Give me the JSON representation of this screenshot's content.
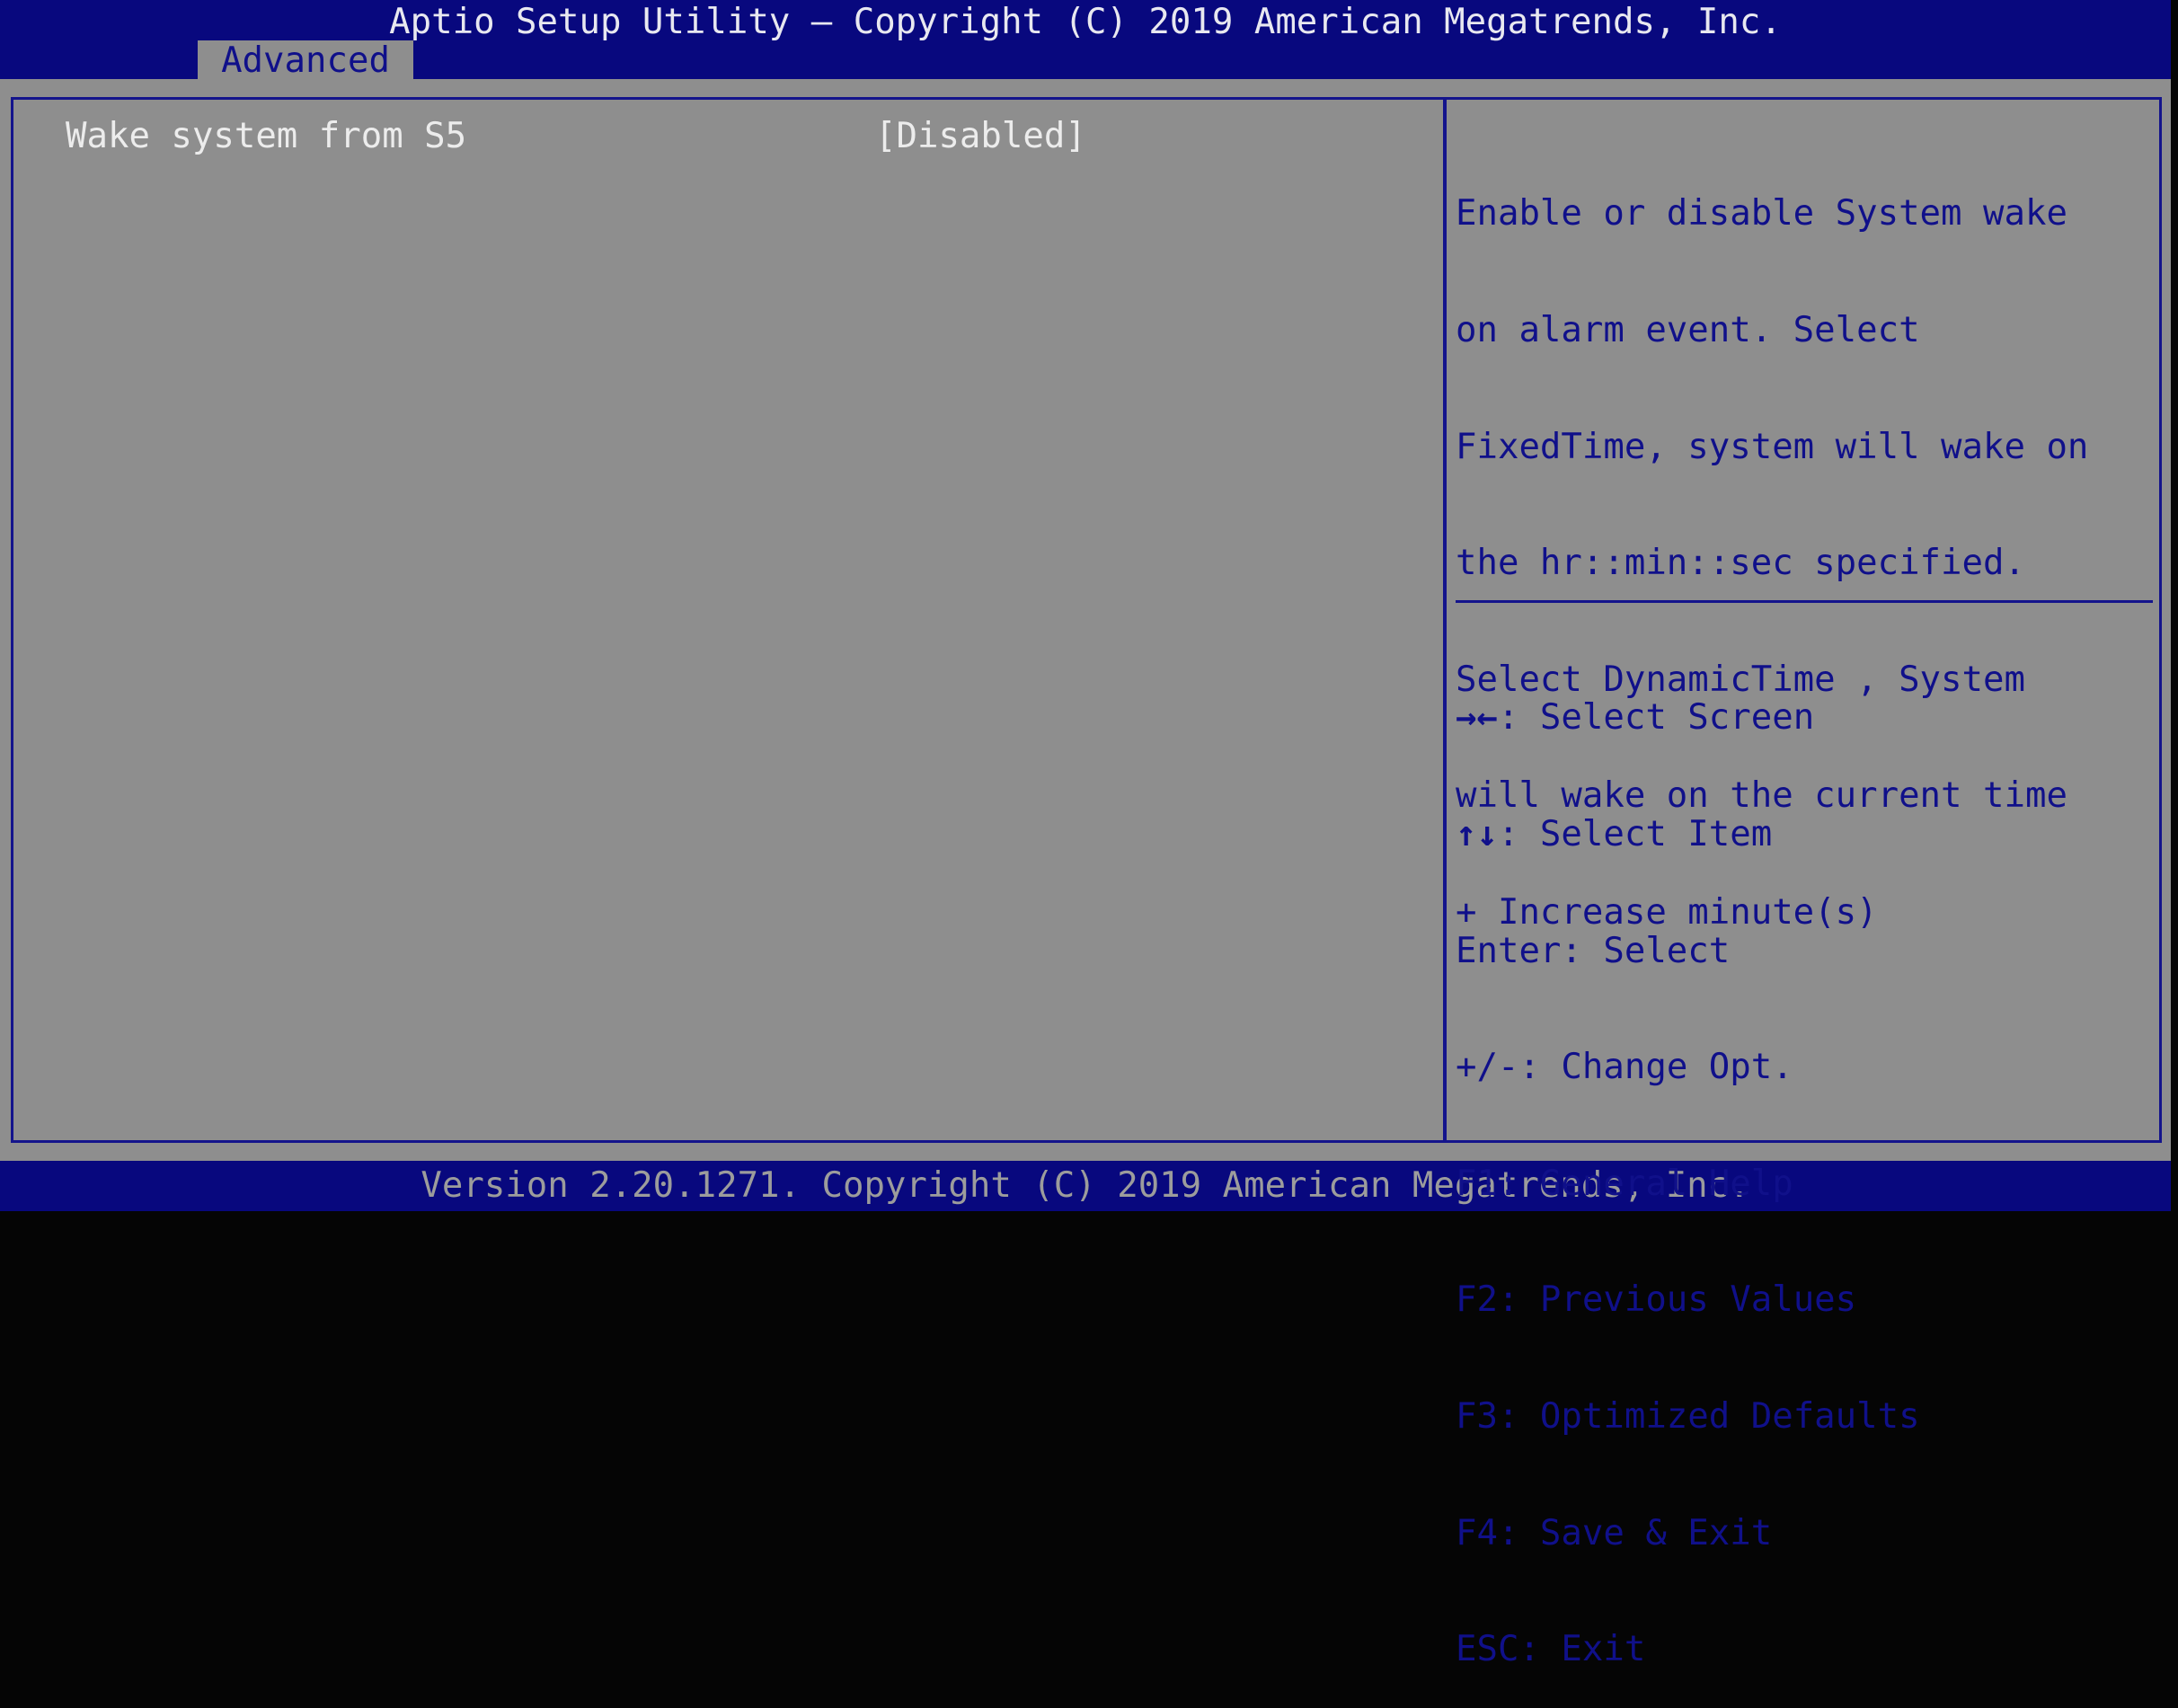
{
  "header": {
    "title": "Aptio Setup Utility – Copyright (C) 2019 American Megatrends, Inc.",
    "tabs": [
      {
        "label": "Advanced",
        "active": true
      }
    ]
  },
  "main": {
    "items": [
      {
        "label": "Wake system from S5",
        "value": "[Disabled]"
      }
    ]
  },
  "help": {
    "lines": [
      "Enable or disable System wake",
      "on alarm event. Select",
      "FixedTime, system will wake on",
      "the hr::min::sec specified.",
      "Select DynamicTime , System",
      "will wake on the current time",
      "+ Increase minute(s)"
    ]
  },
  "keys": [
    {
      "key": "→←",
      "action": ": Select Screen"
    },
    {
      "key": "↑↓",
      "action": ": Select Item"
    },
    {
      "key": "Enter",
      "action": ": Select"
    },
    {
      "key": "+/-",
      "action": ": Change Opt."
    },
    {
      "key": "F1",
      "action": ": General Help"
    },
    {
      "key": "F2",
      "action": ": Previous Values"
    },
    {
      "key": "F3",
      "action": ": Optimized Defaults"
    },
    {
      "key": "F4",
      "action": ": Save & Exit"
    },
    {
      "key": "ESC",
      "action": ": Exit"
    }
  ],
  "footer": {
    "version": "Version 2.20.1271. Copyright (C) 2019 American Megatrends, Inc."
  },
  "colors": {
    "bar_blue": "#08087e",
    "panel_gray": "#8e8e8e",
    "help_text": "#10108a"
  }
}
